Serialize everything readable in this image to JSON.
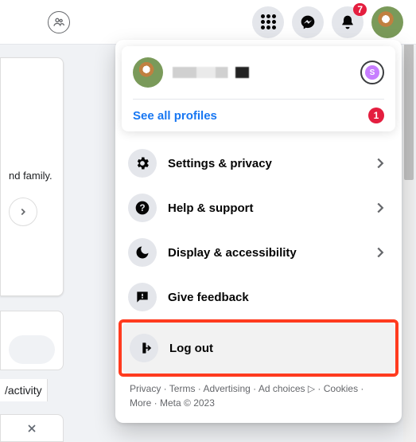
{
  "topbar": {
    "notification_count": "7"
  },
  "left": {
    "snippet": "nd family.",
    "activity_link": "/activity"
  },
  "dropdown": {
    "see_all_label": "See all profiles",
    "see_all_badge": "1",
    "page_switch_letter": "S",
    "items": [
      {
        "label": "Settings & privacy",
        "icon": "gear",
        "chevron": true
      },
      {
        "label": "Help & support",
        "icon": "help",
        "chevron": true
      },
      {
        "label": "Display & accessibility",
        "icon": "moon",
        "chevron": true
      },
      {
        "label": "Give feedback",
        "icon": "feedback",
        "chevron": false
      },
      {
        "label": "Log out",
        "icon": "logout",
        "chevron": false
      }
    ],
    "footer": "Privacy · Terms · Advertising · Ad choices ▷ · Cookies · More · Meta © 2023"
  }
}
